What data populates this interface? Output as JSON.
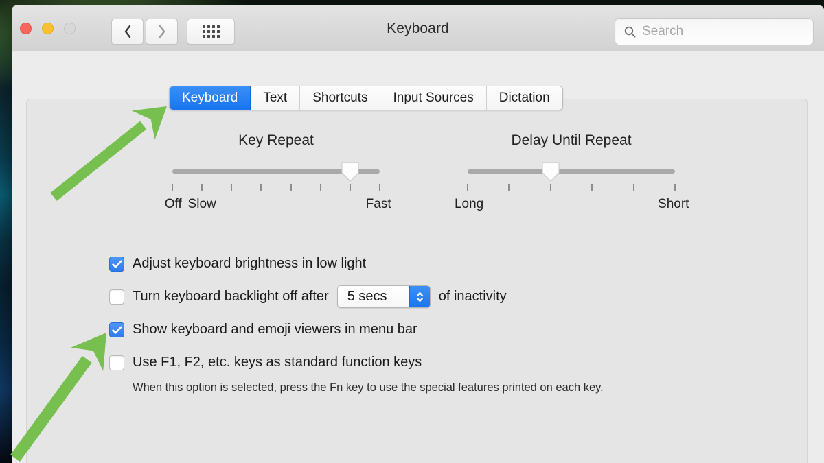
{
  "window": {
    "title": "Keyboard",
    "traffic_lights": [
      {
        "name": "close",
        "color": "#f7655d"
      },
      {
        "name": "minimize",
        "color": "#fcc02e"
      },
      {
        "name": "zoom",
        "color": "#d8d8d8"
      }
    ],
    "nav": {
      "back_icon": "chevron-left-icon",
      "forward_icon": "chevron-right-icon",
      "grid_icon": "show-all-grid-icon"
    },
    "search": {
      "icon": "search-icon",
      "placeholder": "Search",
      "value": ""
    }
  },
  "tabs": [
    {
      "label": "Keyboard",
      "active": true
    },
    {
      "label": "Text",
      "active": false
    },
    {
      "label": "Shortcuts",
      "active": false
    },
    {
      "label": "Input Sources",
      "active": false
    },
    {
      "label": "Dictation",
      "active": false
    }
  ],
  "sliders": [
    {
      "id": "key-repeat",
      "title": "Key Repeat",
      "ticks": 8,
      "value_index": 6,
      "labels": [
        {
          "text": "Off",
          "pos": 0
        },
        {
          "text": "Slow",
          "pos": 1
        },
        {
          "text": "Fast",
          "pos": 7
        }
      ]
    },
    {
      "id": "delay-until-repeat",
      "title": "Delay Until Repeat",
      "ticks": 6,
      "value_index": 2,
      "labels": [
        {
          "text": "Long",
          "pos": 0
        },
        {
          "text": "Short",
          "pos": 5
        }
      ]
    }
  ],
  "options": {
    "adjust_brightness": {
      "label": "Adjust keyboard brightness in low light",
      "checked": true
    },
    "backlight_off": {
      "label": "Turn keyboard backlight off after",
      "checked": false,
      "popup_value": "5 secs",
      "suffix": "of inactivity"
    },
    "show_viewers": {
      "label": "Show keyboard and emoji viewers in menu bar",
      "checked": true
    },
    "function_keys": {
      "label": "Use F1, F2, etc. keys as standard function keys",
      "checked": false,
      "help": "When this option is selected, press the Fn key to use the special features printed on each key."
    }
  },
  "annotations": {
    "color": "#77bf4e",
    "arrows": [
      {
        "name": "arrow-to-keyboard-tab",
        "target": "Keyboard tab"
      },
      {
        "name": "arrow-to-show-viewers",
        "target": "Show keyboard and emoji viewers in menu bar checkbox"
      }
    ]
  },
  "colors": {
    "accent_blue": "#2f7cf2",
    "tab_active_blue": "#1874ef",
    "window_bg": "#ececec",
    "pane_bg": "#e5e5e5",
    "annotation_green": "#77bf4e"
  }
}
